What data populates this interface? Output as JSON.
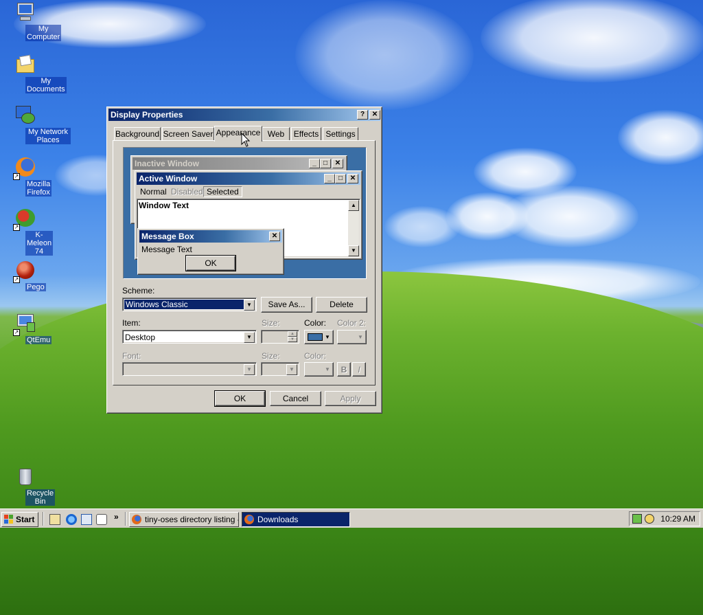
{
  "desktop": {
    "icons": [
      {
        "label": "My Computer",
        "icon": "computer-icon"
      },
      {
        "label": "My Documents",
        "icon": "folder-icon"
      },
      {
        "label": "My Network Places",
        "icon": "network-icon"
      },
      {
        "label": "Mozilla Firefox",
        "icon": "firefox-icon"
      },
      {
        "label": "K-Meleon 74",
        "icon": "kmeleon-icon"
      },
      {
        "label": "Pego",
        "icon": "pego-icon"
      },
      {
        "label": "QtEmu",
        "icon": "qtemu-icon"
      },
      {
        "label": "Recycle Bin",
        "icon": "recycle-bin-icon"
      }
    ]
  },
  "dialog": {
    "title": "Display Properties",
    "help_btn": "?",
    "close_btn": "✕",
    "tabs": [
      "Background",
      "Screen Saver",
      "Appearance",
      "Web",
      "Effects",
      "Settings"
    ],
    "active_tab": "Appearance",
    "preview": {
      "inactive_title": "Inactive Window",
      "active_title": "Active Window",
      "menu": [
        "Normal",
        "Disabled",
        "Selected"
      ],
      "window_text": "Window Text",
      "msgbox_title": "Message Box",
      "msgbox_text": "Message Text",
      "msgbox_ok": "OK"
    },
    "scheme_label": "Scheme:",
    "scheme_value": "Windows Classic",
    "save_as": "Save As...",
    "delete": "Delete",
    "item_label": "Item:",
    "item_value": "Desktop",
    "size_label": "Size:",
    "color_label": "Color:",
    "color2_label": "Color 2:",
    "font_label": "Font:",
    "font_size_label": "Size:",
    "font_color_label": "Color:",
    "bold": "B",
    "italic": "I",
    "ok": "OK",
    "cancel": "Cancel",
    "apply": "Apply",
    "desktop_color": "#3a6ea5"
  },
  "taskbar": {
    "start": "Start",
    "chevron": "»",
    "tasks": [
      {
        "label": "tiny-oses directory listing - ...",
        "active": false
      },
      {
        "label": "Downloads",
        "active": true
      }
    ],
    "clock": "10:29 AM"
  }
}
